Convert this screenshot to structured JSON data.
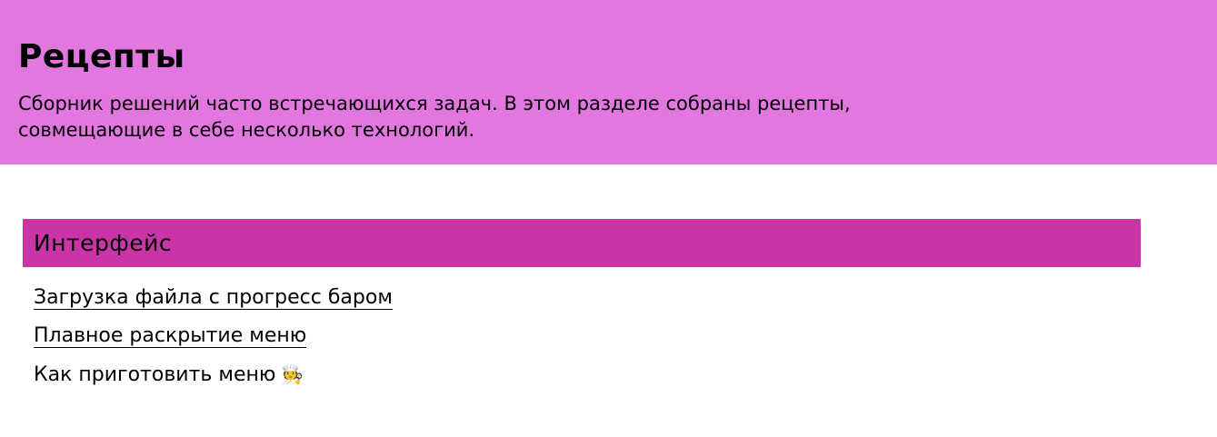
{
  "header": {
    "title": "Рецепты",
    "description": "Сборник решений часто встречающихся задач. В этом разделе собраны рецепты, совмещающие в себе несколько технологий.",
    "background": "#e277e0"
  },
  "section": {
    "title": "Интерфейс",
    "background": "#c935a7",
    "items": [
      {
        "label": "Загрузка файла с прогресс баром",
        "link": true
      },
      {
        "label": "Плавное раскрытие меню",
        "link": true
      },
      {
        "label": "Как приготовить меню",
        "link": false,
        "icon": "chef-icon",
        "icon_glyph": "🧑‍🍳"
      }
    ]
  }
}
